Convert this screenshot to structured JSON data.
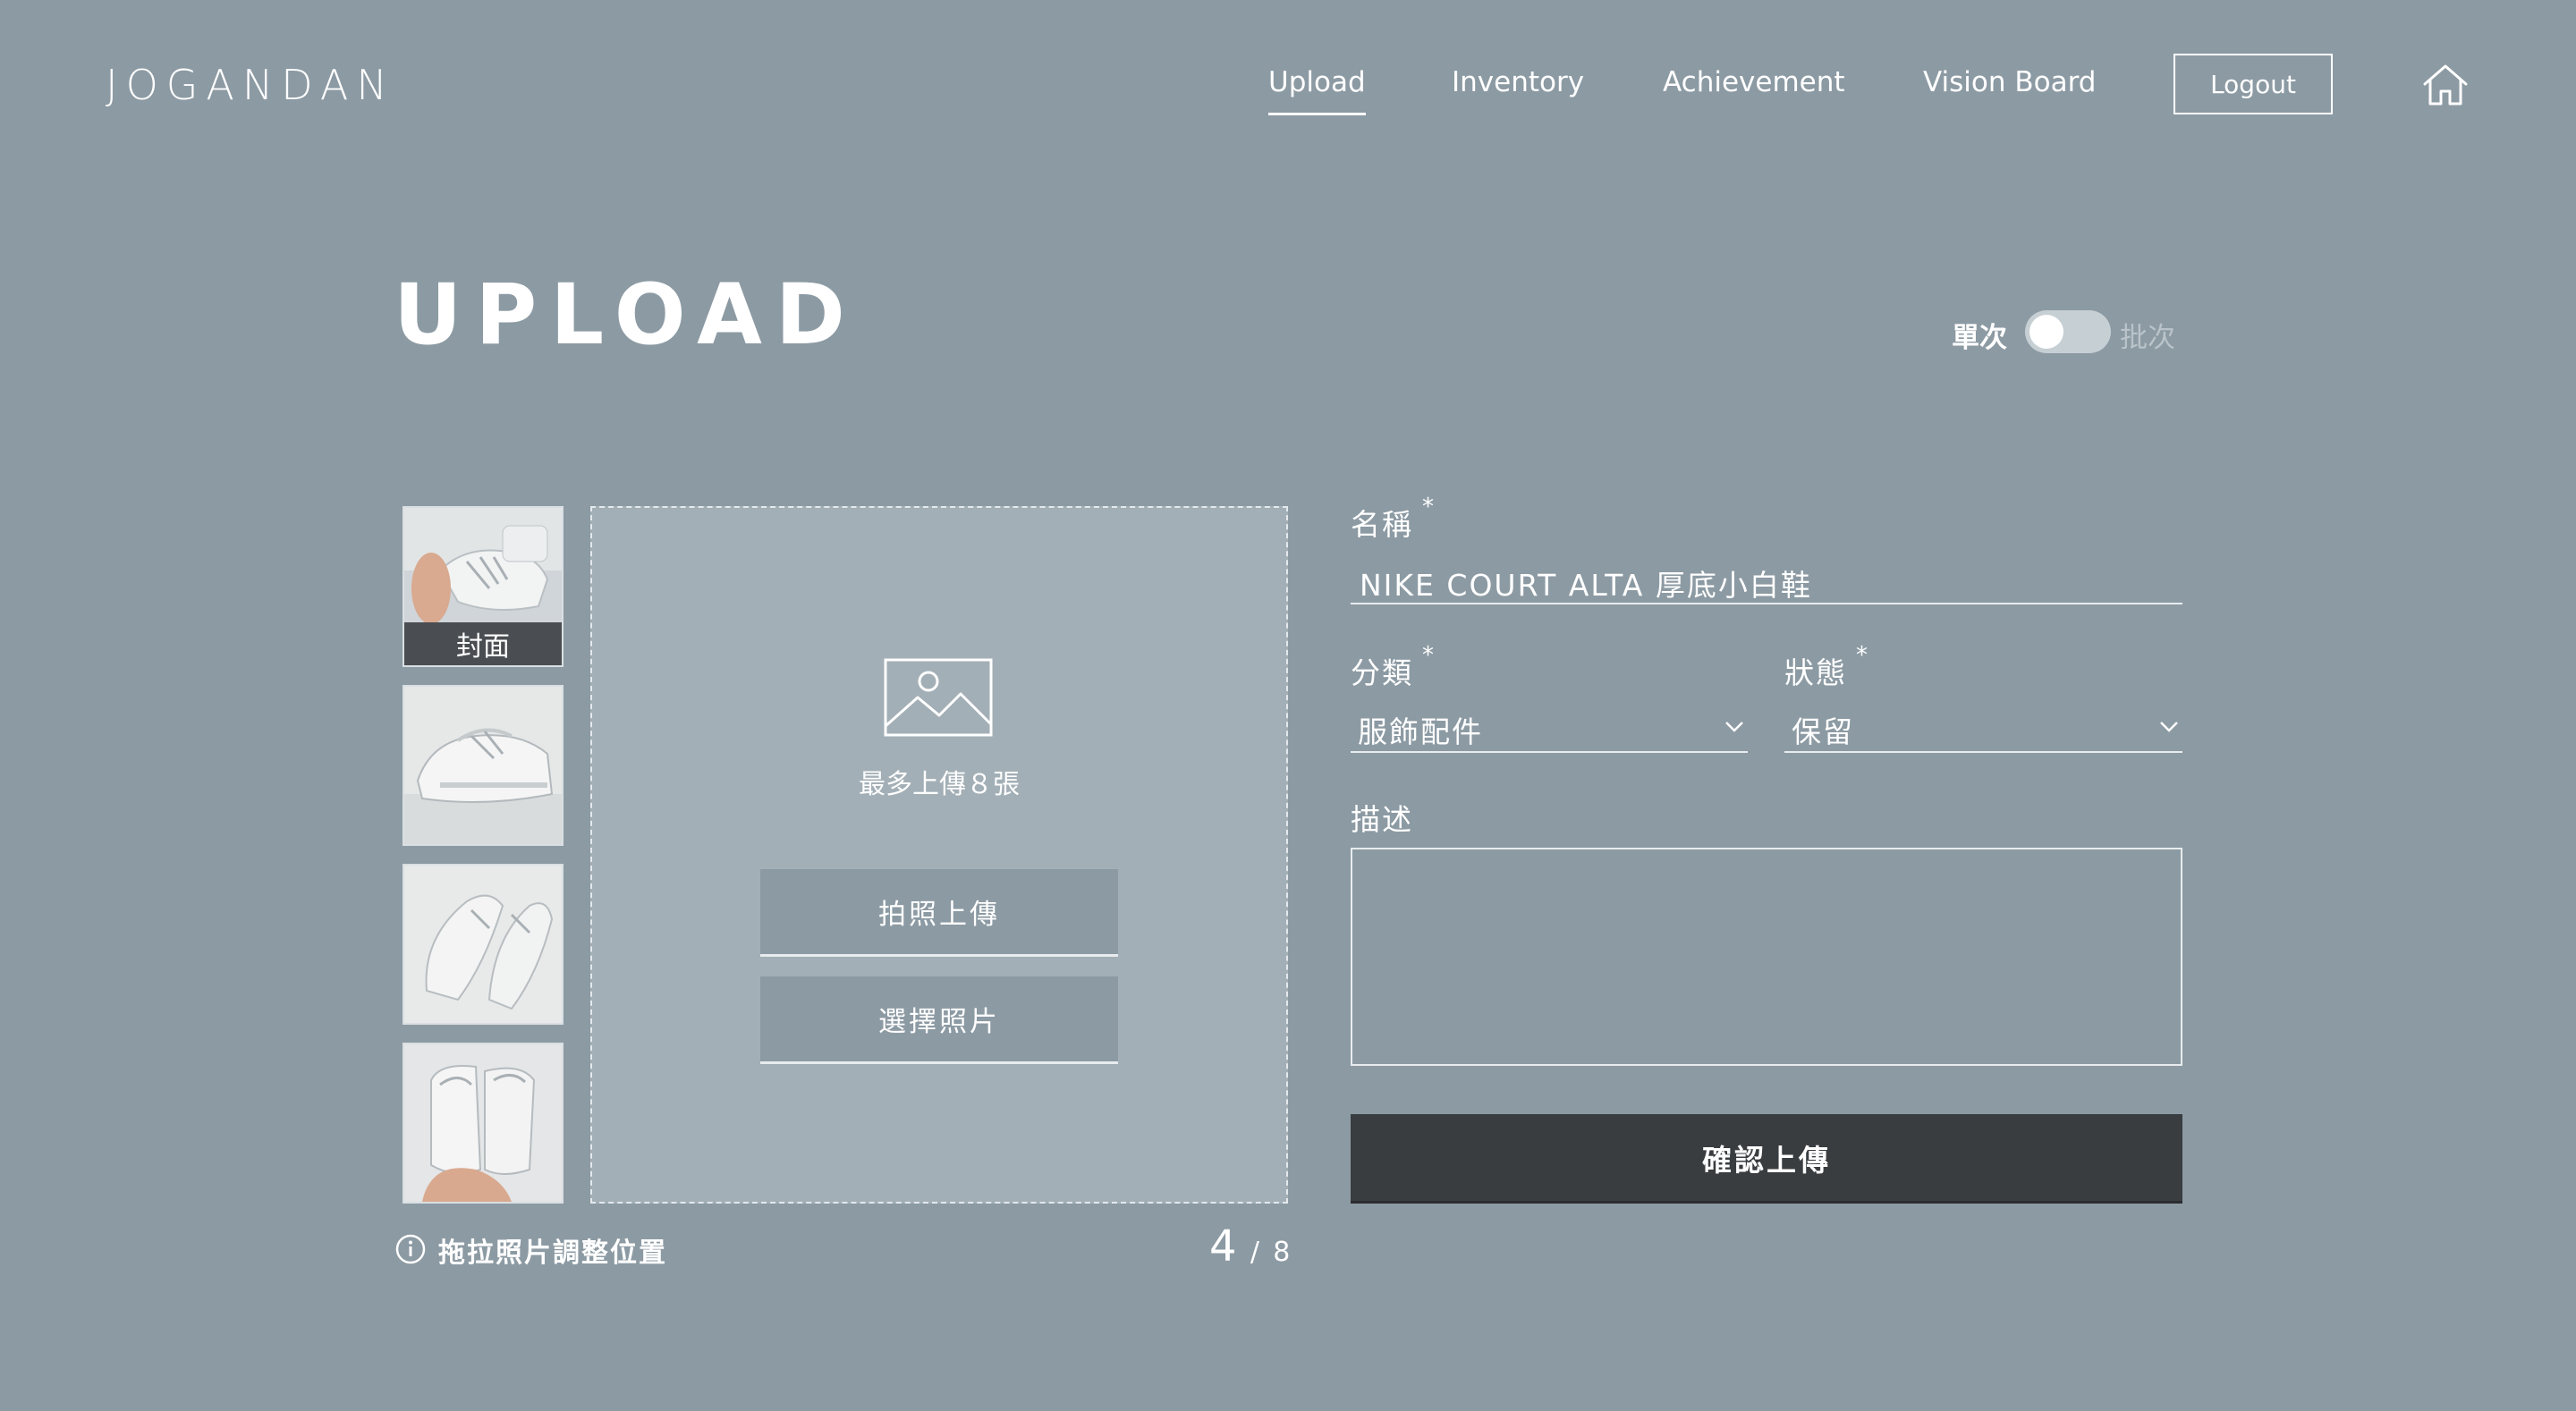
{
  "header": {
    "logo": "JOGANDAN",
    "nav": [
      {
        "label": "Upload",
        "active": true
      },
      {
        "label": "Inventory",
        "active": false
      },
      {
        "label": "Achievement",
        "active": false
      },
      {
        "label": "Vision Board",
        "active": false
      }
    ],
    "logout_label": "Logout",
    "home_icon": "home-icon"
  },
  "page": {
    "title": "UPLOAD",
    "mode_toggle": {
      "left_label": "單次",
      "right_label": "批次",
      "state": "單次"
    }
  },
  "photos": {
    "cover_label": "封面",
    "thumbnails": [
      "sneaker-photo-1",
      "sneaker-photo-2",
      "sneaker-photo-3",
      "sneaker-photo-4"
    ],
    "dropzone_text": "最多上傳８張",
    "take_photo_label": "拍照上傳",
    "choose_photo_label": "選擇照片",
    "hint": "拖拉照片調整位置",
    "count_current": "4",
    "count_sep": "/",
    "count_max": "8"
  },
  "form": {
    "name_label": "名稱",
    "name_value": "NIKE COURT ALTA 厚底小白鞋",
    "category_label": "分類",
    "category_value": "服飾配件",
    "status_label": "狀態",
    "status_value": "保留",
    "required_mark": "*",
    "description_label": "描述",
    "description_value": "",
    "submit_label": "確認上傳"
  },
  "colors": {
    "background": "#8c9aa3",
    "dropzone": "#a3afb6",
    "submit": "#393d40",
    "text": "#ffffff"
  }
}
